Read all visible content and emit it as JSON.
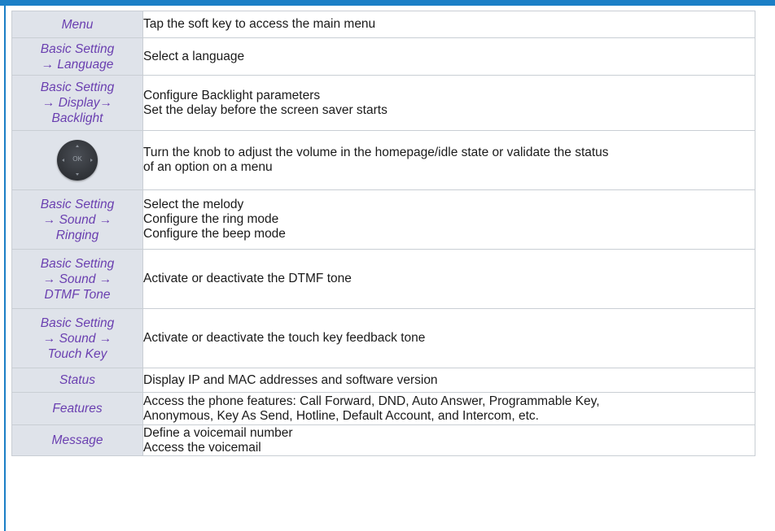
{
  "colors": {
    "accent_bar": "#1b7fc6",
    "label_cell_bg": "#dfe3ea",
    "label_text": "#6a3fb0",
    "description_text": "#1a1a1a",
    "border": "#c9ced4"
  },
  "table": {
    "rows": [
      {
        "label": [
          "Menu"
        ],
        "description": [
          "Tap the soft key to access the main menu"
        ]
      },
      {
        "label": [
          "Basic Setting",
          "→ Language"
        ],
        "description": [
          "Select a language"
        ]
      },
      {
        "label": [
          "Basic Setting",
          "→ Display→",
          "Backlight"
        ],
        "description": [
          "Configure Backlight parameters",
          "Set the delay before the screen saver starts"
        ]
      },
      {
        "label_icon": "ok-navigation-knob-icon",
        "knob_text": "OK",
        "description": [
          "Turn the knob to adjust the volume in the homepage/idle state or validate the status",
          "of an option on a menu"
        ]
      },
      {
        "label": [
          "Basic Setting",
          "→ Sound →",
          "Ringing"
        ],
        "description": [
          "Select the melody",
          "Configure the ring mode",
          "Configure the beep mode"
        ]
      },
      {
        "label": [
          "Basic Setting",
          "→ Sound →",
          "DTMF Tone"
        ],
        "description": [
          "Activate or deactivate the DTMF tone"
        ]
      },
      {
        "label": [
          "Basic Setting",
          "→ Sound →",
          "Touch Key"
        ],
        "description": [
          "Activate or deactivate the touch key feedback tone"
        ]
      },
      {
        "label": [
          "Status"
        ],
        "description": [
          "Display IP and MAC addresses and software version"
        ]
      },
      {
        "label": [
          "Features"
        ],
        "description": [
          "Access the phone features: Call Forward, DND, Auto Answer, Programmable Key,",
          "Anonymous, Key As Send, Hotline, Default Account, and Intercom, etc."
        ]
      },
      {
        "label": [
          "Message"
        ],
        "description": [
          "Define a voicemail number",
          "Access the voicemail"
        ]
      }
    ]
  }
}
